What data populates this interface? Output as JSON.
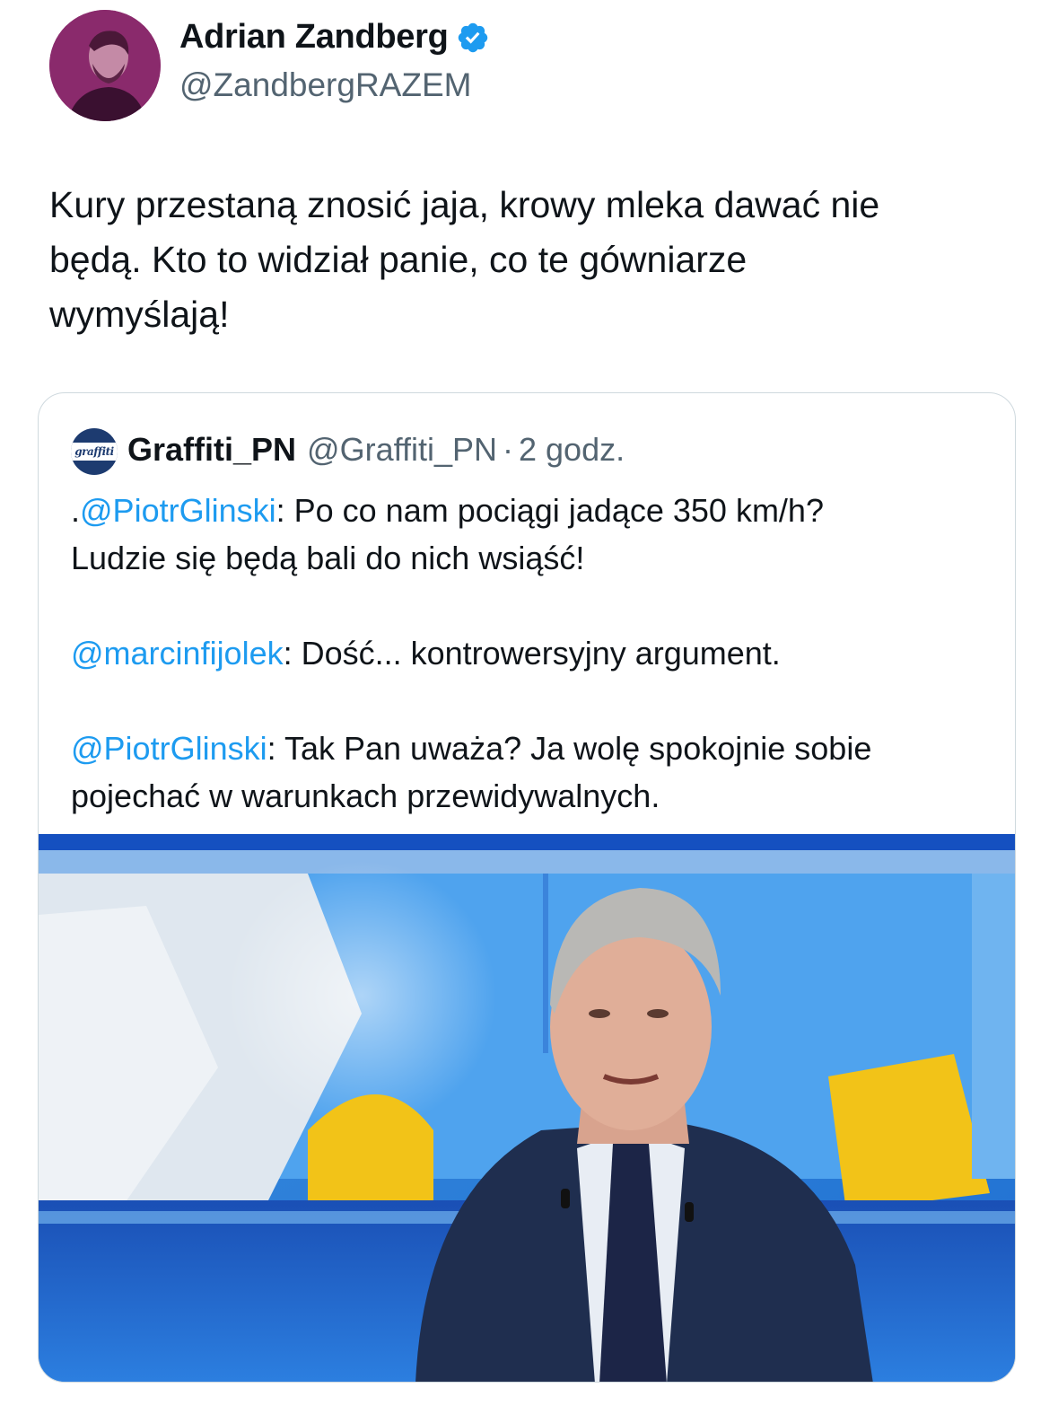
{
  "tweet": {
    "author": {
      "name": "Adrian Zandberg",
      "handle": "@ZandbergRAZEM",
      "verified": true,
      "avatar_color": "#8a2a6c"
    },
    "text_lines": [
      "Kury przestaną znosić jaja, krowy mleka dawać nie",
      "będą. Kto to widział panie, co te gówniarze",
      "wymyślają!"
    ]
  },
  "quote": {
    "author": {
      "name": "Graffiti_PN",
      "handle": "@Graffiti_PN",
      "separator": "·",
      "time": "2 godz.",
      "avatar_text": "graffiti"
    },
    "paragraphs": [
      {
        "lines": [
          {
            "prefix": ".",
            "mention": "@PiotrGlinski",
            "text": ": Po co nam pociągi jadące 350 km/h?"
          },
          {
            "prefix": "",
            "mention": "",
            "text": "Ludzie się będą bali do nich wsiąść!"
          }
        ]
      },
      {
        "lines": [
          {
            "prefix": "",
            "mention": "@marcinfijolek",
            "text": ": Dość... kontrowersyjny argument."
          }
        ]
      },
      {
        "lines": [
          {
            "prefix": "",
            "mention": "@PiotrGlinski",
            "text": ": Tak Pan uważa? Ja wolę spokojnie sobie"
          },
          {
            "prefix": "",
            "mention": "",
            "text": "pojechać w warunkach przewidywalnych."
          }
        ]
      }
    ],
    "media": {
      "description_icon": "tv-studio-photo",
      "accent_blue": "#1f6fd1",
      "accent_yellow": "#f2c318"
    }
  },
  "colors": {
    "text_primary": "#0f1419",
    "text_secondary": "#536471",
    "link": "#1d9bf0",
    "border": "#cfd9de"
  }
}
